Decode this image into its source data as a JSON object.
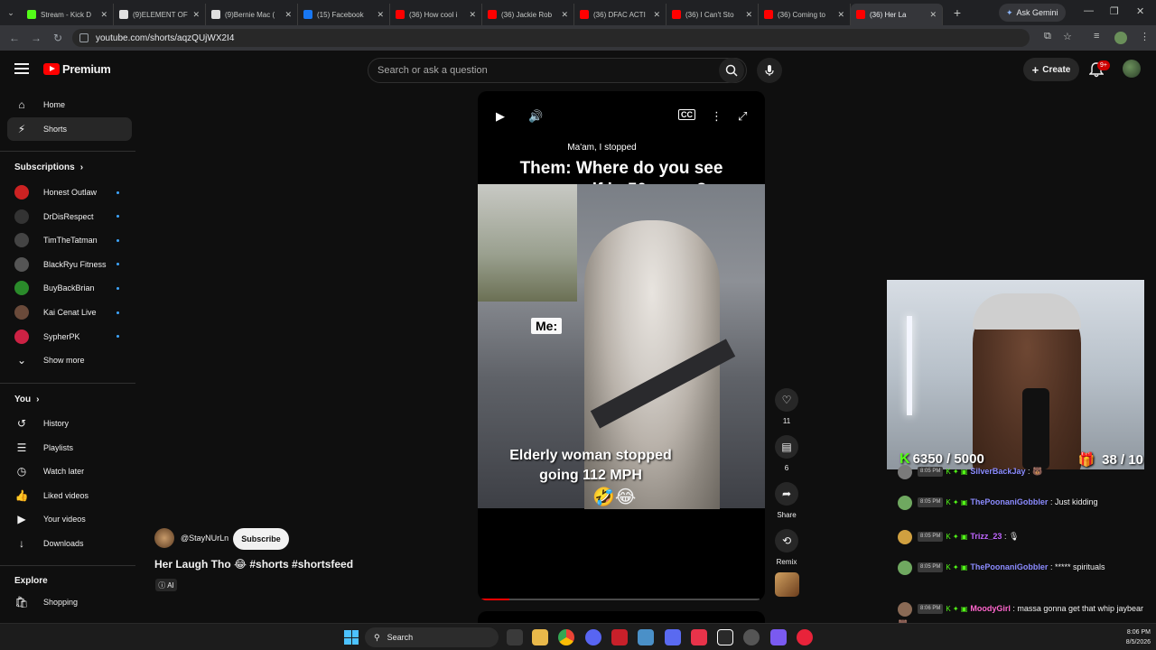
{
  "browser": {
    "tabs": [
      {
        "label": "Stream - Kick D",
        "fav_color": "#53fc18"
      },
      {
        "label": "(9)ELEMENT OF",
        "fav_color": "#e0e0e0"
      },
      {
        "label": "(9)Bernie Mac (",
        "fav_color": "#e0e0e0"
      },
      {
        "label": "(15) Facebook",
        "fav_color": "#1877f2"
      },
      {
        "label": "(36) How cool i",
        "fav_color": "#ff0000"
      },
      {
        "label": "(36) Jackie Rob",
        "fav_color": "#ff0000"
      },
      {
        "label": "(36) DFAC ACTI",
        "fav_color": "#ff0000"
      },
      {
        "label": "(36) I Can't Sto",
        "fav_color": "#ff0000"
      },
      {
        "label": "(36) Coming to",
        "fav_color": "#ff0000"
      },
      {
        "label": "(36) Her La",
        "fav_color": "#ff0000"
      }
    ],
    "ask_gemini": "Ask Gemini",
    "url": "youtube.com/shorts/aqzQUjWX2I4"
  },
  "header": {
    "logo_text": "Premium",
    "search_placeholder": "Search or ask a question",
    "create_label": "Create",
    "notif_count": "9+"
  },
  "sidebar": {
    "main": [
      {
        "label": "Home",
        "icon": "home-icon",
        "glyph": "⌂"
      },
      {
        "label": "Shorts",
        "icon": "shorts-icon",
        "glyph": "⚡"
      }
    ],
    "subscriptions_title": "Subscriptions",
    "subscriptions": [
      {
        "label": "Honest Outlaw",
        "color": "#cc2222"
      },
      {
        "label": "DrDisRespect",
        "color": "#333333"
      },
      {
        "label": "TimTheTatman",
        "color": "#444444"
      },
      {
        "label": "BlackRyu Fitness",
        "color": "#555555"
      },
      {
        "label": "BuyBackBrian",
        "color": "#2a8a2a"
      },
      {
        "label": "Kai Cenat Live",
        "color": "#6a4a3a"
      },
      {
        "label": "SypherPK",
        "color": "#cc2244"
      }
    ],
    "show_more": "Show more",
    "you_title": "You",
    "you_items": [
      {
        "label": "History",
        "icon": "history-icon",
        "glyph": "↺"
      },
      {
        "label": "Playlists",
        "icon": "playlists-icon",
        "glyph": "☰"
      },
      {
        "label": "Watch later",
        "icon": "watch-later-icon",
        "glyph": "◷"
      },
      {
        "label": "Liked videos",
        "icon": "like-icon",
        "glyph": "👍"
      },
      {
        "label": "Your videos",
        "icon": "your-videos-icon",
        "glyph": "▶"
      },
      {
        "label": "Downloads",
        "icon": "download-icon",
        "glyph": "↓"
      }
    ],
    "explore_title": "Explore",
    "explore_items": [
      {
        "label": "Shopping",
        "icon": "shopping-icon",
        "glyph": "🛍"
      }
    ]
  },
  "short": {
    "caption_small": "Ma'am, I stopped",
    "caption_big": "Them: Where do you see yourself in 50 years?",
    "me_label": "Me:",
    "elder_caption": "Elderly woman stopped going 112 MPH",
    "emojis": "🤣😂",
    "progress": 0.1,
    "channel": "@StayNUrLn",
    "subscribe_label": "Subscribe",
    "title": "Her Laugh Tho 😂 #shorts #shortsfeed",
    "ai_label": "AI",
    "likes": "11",
    "comments": "6",
    "share_label": "Share",
    "remix_label": "Remix"
  },
  "stream": {
    "kick_progress": "6350 / 5000",
    "gift_progress": "38 / 10",
    "chat": [
      {
        "time": "8:05 PM",
        "user": "SilverBackJay",
        "user_color": "#8b8bff",
        "text": ": 🐻",
        "avatar": "#7a7a7a"
      },
      {
        "time": "8:05 PM",
        "user": "ThePoonaniGobbler",
        "user_color": "#8b8bff",
        "text": ": Just kidding",
        "avatar": "#6fa860"
      },
      {
        "time": "8:05 PM",
        "user": "Trizz_23",
        "user_color": "#c066ff",
        "text": ": 🎙",
        "avatar": "#d0a040"
      },
      {
        "time": "8:05 PM",
        "user": "ThePoonaniGobbler",
        "user_color": "#8b8bff",
        "text": ": ***** spirituals",
        "avatar": "#6fa860"
      },
      {
        "time": "8:06 PM",
        "user": "MoodyGirl",
        "user_color": "#ff66cc",
        "text": ": massa gonna get that whip jaybear 🐻",
        "avatar": "#8a6a55"
      }
    ]
  },
  "taskbar": {
    "search_label": "Search",
    "time": "8:06 PM",
    "date": "8/5/2026"
  }
}
